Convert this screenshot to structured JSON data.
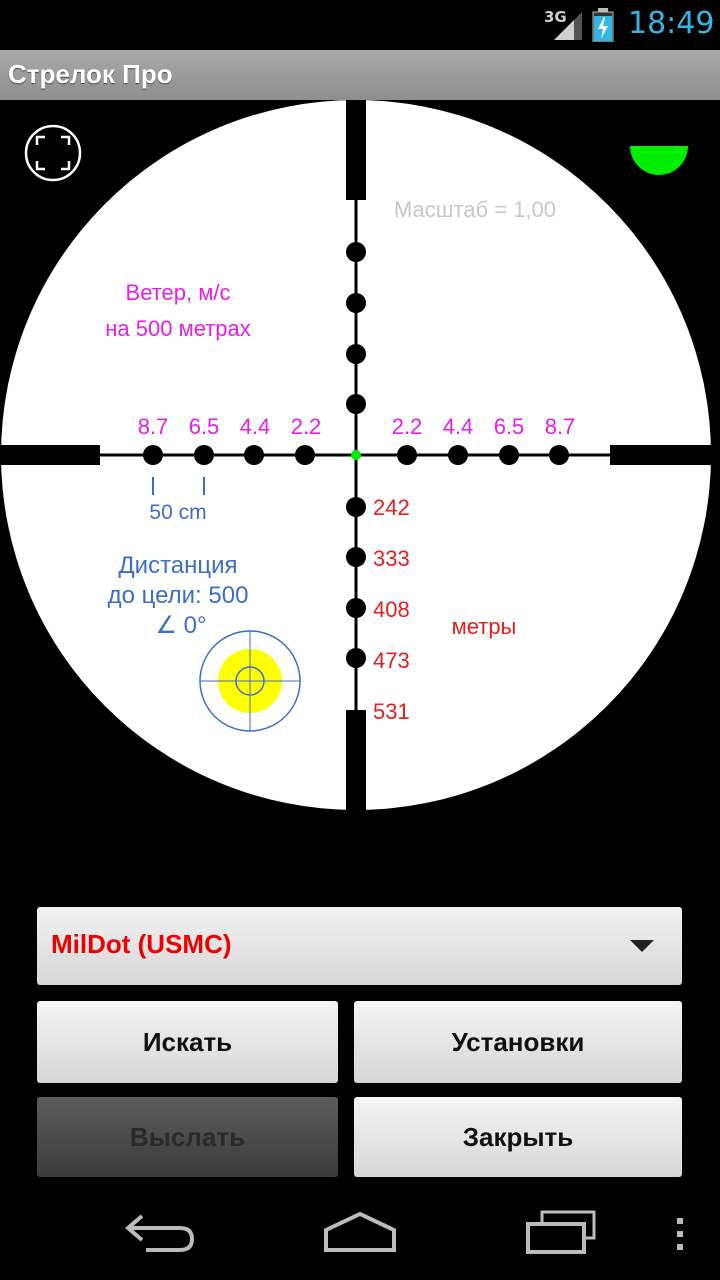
{
  "status_bar": {
    "network_type": "3G",
    "time": "18:49"
  },
  "app": {
    "title": "Стрелок Про"
  },
  "reticle": {
    "scale_label": "Масштаб = 1,00",
    "wind_label_line1": "Ветер, м/с",
    "wind_label_line2": "на 500 метрах",
    "wind_values_left": [
      "8.7",
      "6.5",
      "4.4",
      "2.2"
    ],
    "wind_values_right": [
      "2.2",
      "4.4",
      "6.5",
      "8.7"
    ],
    "size_label": "50 cm",
    "distance_line1": "Дистанция",
    "distance_line2": "до цели: 500",
    "angle_label": "∠  0°",
    "range_values": [
      "242",
      "333",
      "408",
      "473",
      "531"
    ],
    "meters_label": "метры",
    "colors": {
      "wind": "#e61ee6",
      "range": "#e61e1e",
      "info": "#3c6ec8",
      "scale": "#c8c8c8",
      "level": "#00ee00",
      "target": "#ffff00"
    }
  },
  "controls": {
    "reticle_select_value": "MilDot (USMC)",
    "search_label": "Искать",
    "settings_label": "Установки",
    "send_label": "Выслать",
    "close_label": "Закрыть"
  },
  "icons": [
    "signal-icon",
    "battery-icon",
    "fullscreen-icon",
    "level-indicator-icon",
    "target-icon",
    "back-icon",
    "home-icon",
    "recent-apps-icon",
    "menu-icon"
  ]
}
